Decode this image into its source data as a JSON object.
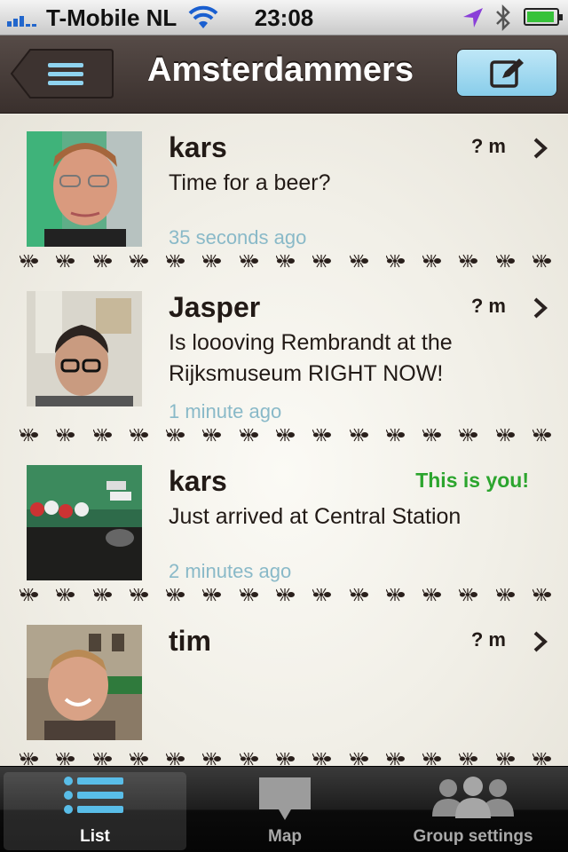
{
  "status": {
    "carrier": "T-Mobile NL",
    "time": "23:08",
    "battery_level": 0.95
  },
  "nav": {
    "title": "Amsterdammers"
  },
  "feed": [
    {
      "name": "kars",
      "distance": "? m",
      "message": "Time for a beer?",
      "time": "35 seconds ago"
    },
    {
      "name": "Jasper",
      "distance": "? m",
      "message": "Is loooving Rembrandt at the Rijksmuseum RIGHT NOW!",
      "time": "1 minute ago"
    },
    {
      "name": "kars",
      "distance": "",
      "you_label": "This is you!",
      "message": "Just arrived at Central Station",
      "time": "2 minutes ago"
    },
    {
      "name": "tim",
      "distance": "? m",
      "message": "",
      "time": ""
    }
  ],
  "tabs": [
    {
      "label": "List",
      "icon": "list-icon",
      "active": true
    },
    {
      "label": "Map",
      "icon": "map-icon",
      "active": false
    },
    {
      "label": "Group settings",
      "icon": "group-icon",
      "active": false
    }
  ],
  "colors": {
    "accent_blue": "#88cdea",
    "nav_brown": "#4a3f3b",
    "you_green": "#2ca52e",
    "time_blue": "#89b9c8"
  }
}
